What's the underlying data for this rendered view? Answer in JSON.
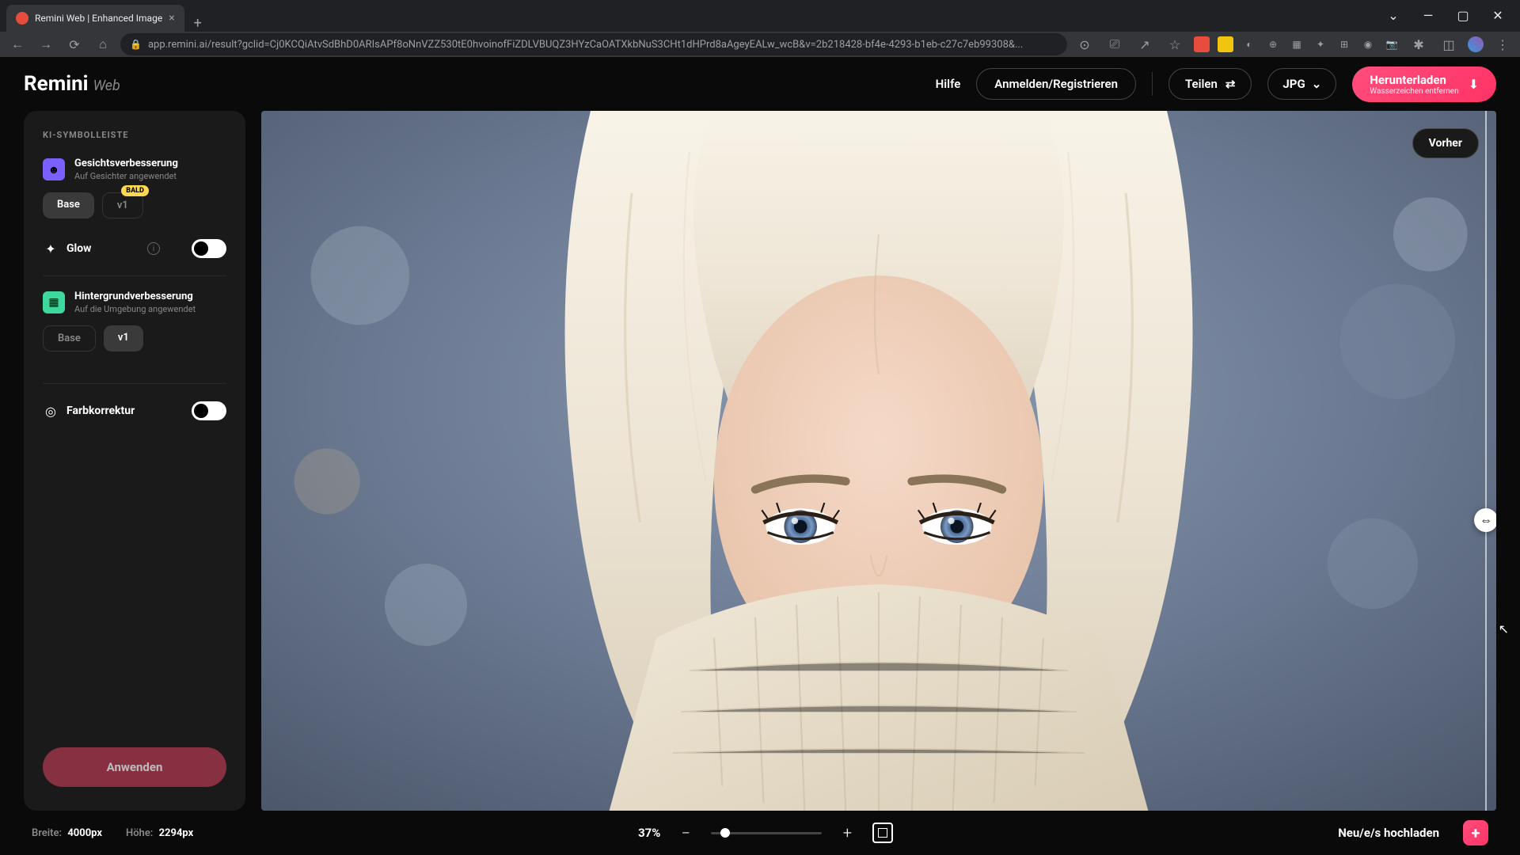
{
  "browser": {
    "tab_title": "Remini Web | Enhanced Image",
    "url": "app.remini.ai/result?gclid=Cj0KCQiAtvSdBhD0ARIsAPf8oNnVZZ530tE0hvoinofFiZDLVBUQZ3HYzCaOATXkbNuS3CHt1dHPrd8aAgeyEALw_wcB&v=2b218428-bf4e-4293-b1eb-c27c7eb99308&..."
  },
  "header": {
    "logo_main": "Remini",
    "logo_sub": "Web",
    "help": "Hilfe",
    "login": "Anmelden/Registrieren",
    "share": "Teilen",
    "format": "JPG",
    "download_main": "Herunterladen",
    "download_sub": "Wasserzeichen entfernen"
  },
  "sidebar": {
    "title": "KI-SYMBOLLEISTE",
    "face": {
      "name": "Gesichtsverbesserung",
      "desc": "Auf Gesichter angewendet",
      "base": "Base",
      "v1": "v1",
      "badge": "BALD"
    },
    "glow": {
      "label": "Glow"
    },
    "bg": {
      "name": "Hintergrundverbesserung",
      "desc": "Auf die Umgebung angewendet",
      "base": "Base",
      "v1": "v1"
    },
    "color": {
      "label": "Farbkorrektur"
    },
    "apply": "Anwenden"
  },
  "canvas": {
    "before": "Vorher"
  },
  "footer": {
    "width_label": "Breite:",
    "width_value": "4000px",
    "height_label": "Höhe:",
    "height_value": "2294px",
    "zoom": "37%",
    "upload": "Neu/e/s hochladen"
  }
}
